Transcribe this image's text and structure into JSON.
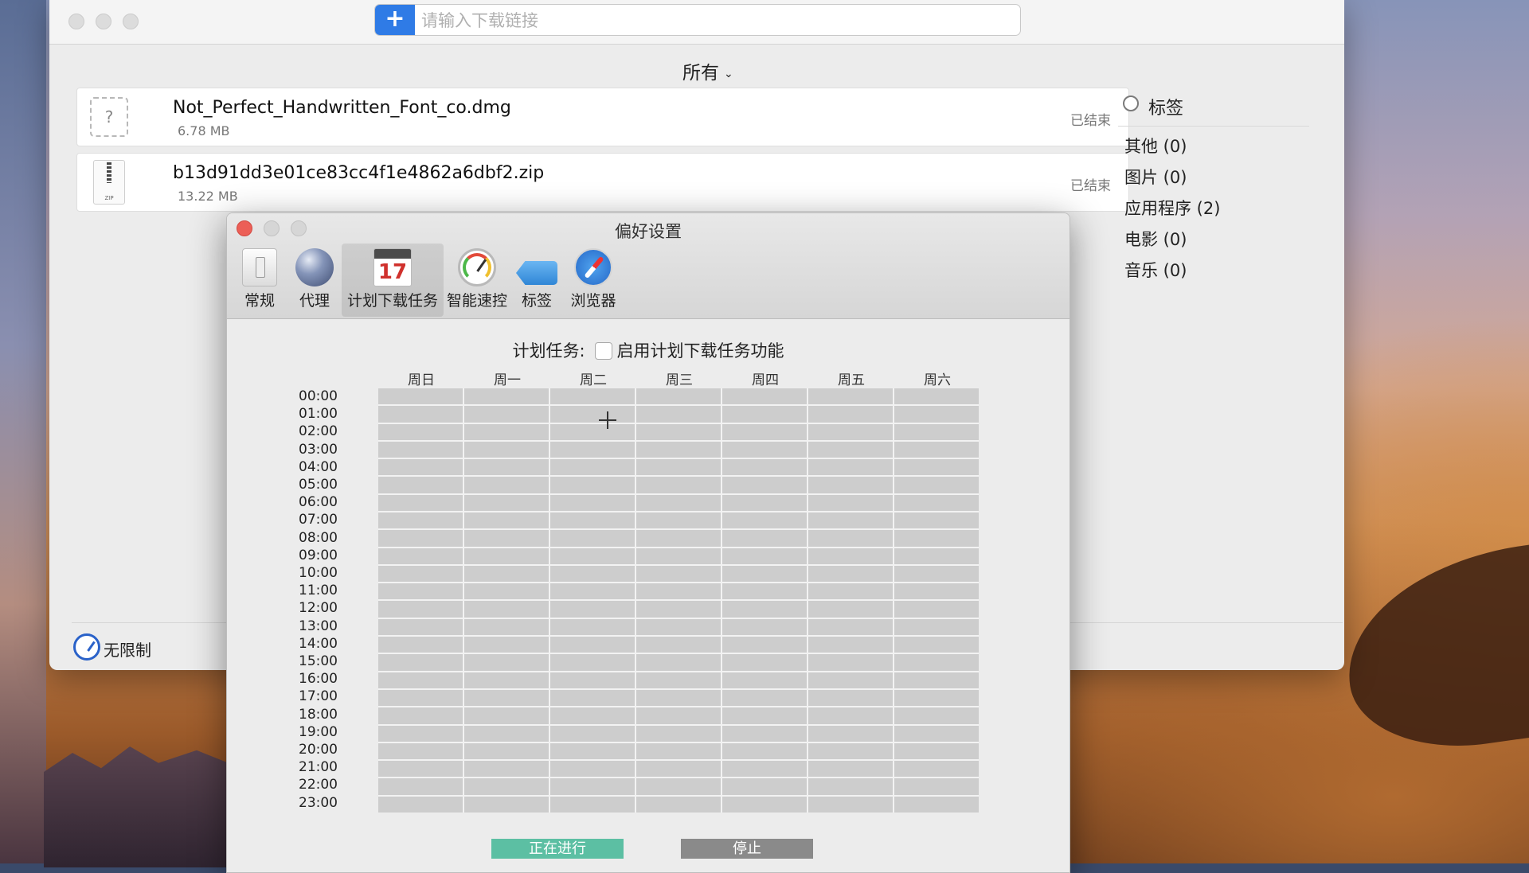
{
  "main": {
    "url_placeholder": "请输入下载链接",
    "plus_label": "+",
    "filter_label": "所有",
    "downloads": [
      {
        "name": "Not_Perfect_Handwritten_Font_co.dmg",
        "size": "6.78 MB",
        "status": "已结束"
      },
      {
        "name": "b13d91dd3e01ce83cc4f1e4862a6dbf2.zip",
        "size": "13.22 MB",
        "status": "已结束"
      }
    ],
    "tags": {
      "title": "标签",
      "items": [
        "其他 (0)",
        "图片 (0)",
        "应用程序 (2)",
        "电影 (0)",
        "音乐 (0)"
      ]
    },
    "speed_limit": "无限制"
  },
  "prefs": {
    "title": "偏好设置",
    "tabs": [
      "常规",
      "代理",
      "计划下载任务",
      "智能速控",
      "标签",
      "浏览器"
    ],
    "calendar_day": "17",
    "schedule_label": "计划任务:",
    "enable_label": "启用计划下载任务功能",
    "days": [
      "周日",
      "周一",
      "周二",
      "周三",
      "周四",
      "周五",
      "周六"
    ],
    "hours": [
      "00:00",
      "01:00",
      "02:00",
      "03:00",
      "04:00",
      "05:00",
      "06:00",
      "07:00",
      "08:00",
      "09:00",
      "10:00",
      "11:00",
      "12:00",
      "13:00",
      "14:00",
      "15:00",
      "16:00",
      "17:00",
      "18:00",
      "19:00",
      "20:00",
      "21:00",
      "22:00",
      "23:00"
    ],
    "run_button": "正在进行",
    "stop_button": "停止"
  },
  "colors": {
    "accent_blue": "#2f7be6",
    "close_red": "#ec5f57",
    "run_green": "#5cbfa3",
    "stop_gray": "#8a8a8a"
  }
}
